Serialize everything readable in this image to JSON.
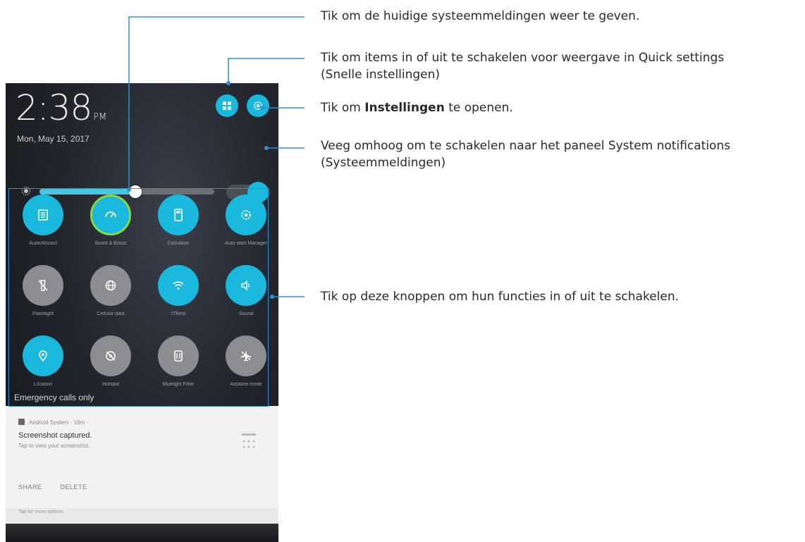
{
  "status": {
    "time": "2:38",
    "ampm": "PM",
    "date": "Mon, May 15, 2017"
  },
  "brightness": {
    "level_fraction": 0.55,
    "auto_enabled": true
  },
  "tiles": [
    {
      "label": "AudioWizard",
      "on": true,
      "icon": "audio-wizard-icon"
    },
    {
      "label": "Boost & Boost",
      "on": true,
      "icon": "speed-gauge-icon"
    },
    {
      "label": "Calculator",
      "on": true,
      "icon": "calculator-icon"
    },
    {
      "label": "Auto-start Manager",
      "on": true,
      "icon": "auto-start-icon"
    },
    {
      "label": "Flashlight",
      "on": false,
      "icon": "flashlight-icon"
    },
    {
      "label": "Cellular data",
      "on": false,
      "icon": "globe-icon"
    },
    {
      "label": "ITBest",
      "on": true,
      "icon": "wifi-icon"
    },
    {
      "label": "Sound",
      "on": true,
      "icon": "speaker-icon"
    },
    {
      "label": "Location",
      "on": true,
      "icon": "location-pin-icon"
    },
    {
      "label": "Hotspot",
      "on": false,
      "icon": "hotspot-icon"
    },
    {
      "label": "Bluelight Filter",
      "on": false,
      "icon": "bluelight-filter-icon"
    },
    {
      "label": "Airplane mode",
      "on": false,
      "icon": "airplane-icon"
    }
  ],
  "emergency_text": "Emergency calls only",
  "notification": {
    "app": "Android System · 18m ·",
    "title": "Screenshot captured.",
    "subtitle": "Tap to view your screenshot.",
    "actions": [
      "SHARE",
      "DELETE"
    ],
    "peek": "Tap for more options"
  },
  "callouts": {
    "c1": "Tik om de huidige systeemmeldingen weer te geven.",
    "c2_line1": "Tik om items in of uit te schakelen voor weergave in Quick settings",
    "c2_line2": "(Snelle instellingen)",
    "c3_prefix": "Tik om ",
    "c3_bold": "Instellingen",
    "c3_suffix": " te openen.",
    "c4_line1": "Veeg omhoog om te schakelen naar het paneel System notifications",
    "c4_line2": "(Systeemmeldingen)",
    "c5": "Tik op deze knoppen om hun functies in of uit te schakelen."
  },
  "colors": {
    "accent": "#1bb8dd",
    "off": "#8b8d90",
    "callout_line": "#2f8fd1",
    "highlight_box": "#2f8fd1"
  }
}
